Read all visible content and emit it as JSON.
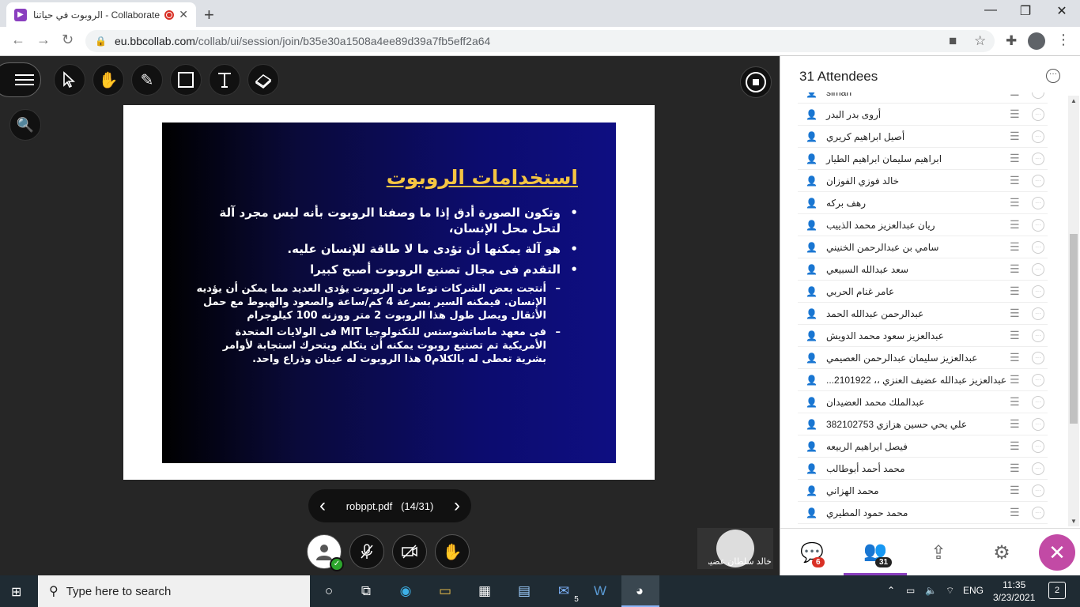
{
  "browser": {
    "tab_title": "الروبوت في حياتنا - Collaborate",
    "tab_close": "✕",
    "new_tab": "+",
    "url_host": "eu.bbcollab.com",
    "url_path": "/collab/ui/session/join/b35e30a1508a4ee89d39a7fb5eff2a64",
    "window_controls": {
      "minimize": "—",
      "maximize": "❐",
      "close": "✕"
    }
  },
  "toolbar": {
    "tools": [
      "select-tool",
      "pan-tool",
      "pen-tool",
      "shape-tool",
      "text-tool",
      "eraser-tool"
    ]
  },
  "slide": {
    "title": "استخدامات الروبوت",
    "bullets": [
      "وتكون الصورة أدق إذا ما وصفنا الروبوت بأنه ليس مجرد آلة لتحل محل الإنسان،",
      "هو آلة يمكنها أن تؤدى ما لا طاقة للإنسان عليه.",
      "التقدم فى مجال تصنيع الروبوت أصبح كبيرا"
    ],
    "sub_bullets": [
      "أنتجت بعض الشركات نوعا من الروبوت يؤدى العديد مما يمكن أن يؤديه الإنسان. فيمكنه السير بسرعة 4 كم/ساعة والصعود والهبوط مع حمل الأثقال ويصل طول هذا الروبوت 2 متر ووزنه 100 كيلوجرام",
      "فى معهد ماساتشوستس للتكنولوجيا MIT فى الولايات المتحدة الأمريكية تم تصنيع روبوت يمكنه أن يتكلم ويتحرك استجابة لأوامر بشرية تعطى له بالكلام0 هذا الروبوت له عينان وذراع واحد."
    ],
    "bullet_glyph": "•",
    "dash_glyph": "–"
  },
  "pager": {
    "label": "robppt.pdf",
    "position": "(14/31)"
  },
  "speaker": {
    "name": "خالد سلطان عضير..."
  },
  "panel": {
    "title": "31 Attendees",
    "attendees": [
      "slman",
      "أروى بدر البدر",
      "أصيل ابراهيم كريري",
      "ابراهيم سليمان ابراهيم الطيار",
      "خالد فوزي الفوزان",
      "رهف بركه",
      "ريان عبدالعزيز محمد الذييب",
      "سامي بن عبدالرحمن الخنيني",
      "سعد عبدالله السبيعي",
      "عامر غنام الحربي",
      "عبدالرحمن عبدالله الحمد",
      "عبدالعزيز سعود محمد الدويش",
      "عبدالعزيز سليمان عبدالرحمن العصيمي",
      "عبدالعزيز عبدالله عضيف العنزي ،، 2101922...",
      "عبدالملك محمد العضيدان",
      "علي يحي حسين هزازي 382102753",
      "فيصل ابراهيم الربيعه",
      "محمد أحمد أبوطالب",
      "محمد الهزاني",
      "محمد حمود المطيري"
    ],
    "chat_badge": "6",
    "attendees_badge": "31"
  },
  "taskbar": {
    "search_placeholder": "Type here to search",
    "mail_badge": "5",
    "language": "ENG",
    "time": "11:35",
    "date": "3/23/2021",
    "notifications": "2"
  },
  "colors": {
    "accent": "#8a3fbf",
    "close_button": "#c24aa5",
    "slide_title": "#f5c542",
    "chat_badge": "#d93025",
    "attendees_badge": "#222222"
  }
}
